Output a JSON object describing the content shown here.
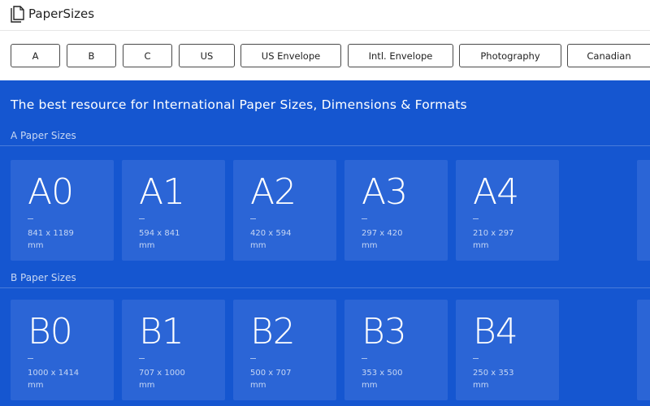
{
  "header": {
    "brand": "PaperSizes",
    "logo_icon": "document-pages-icon"
  },
  "tabs": [
    {
      "label": "A"
    },
    {
      "label": "B"
    },
    {
      "label": "C"
    },
    {
      "label": "US"
    },
    {
      "label": "US Envelope"
    },
    {
      "label": "Intl. Envelope"
    },
    {
      "label": "Photography"
    },
    {
      "label": "Canadian"
    }
  ],
  "hero": {
    "text": "The best resource for International Paper Sizes, Dimensions & Formats"
  },
  "sections": [
    {
      "title": "A Paper Sizes",
      "cards": [
        {
          "name": "A0",
          "dims": "841 x 1189",
          "unit": "mm"
        },
        {
          "name": "A1",
          "dims": "594 x 841",
          "unit": "mm"
        },
        {
          "name": "A2",
          "dims": "420 x 594",
          "unit": "mm"
        },
        {
          "name": "A3",
          "dims": "297 x 420",
          "unit": "mm"
        },
        {
          "name": "A4",
          "dims": "210 x 297",
          "unit": "mm"
        }
      ]
    },
    {
      "title": "B Paper Sizes",
      "cards": [
        {
          "name": "B0",
          "dims": "1000 x 1414",
          "unit": "mm"
        },
        {
          "name": "B1",
          "dims": "707 x 1000",
          "unit": "mm"
        },
        {
          "name": "B2",
          "dims": "500 x 707",
          "unit": "mm"
        },
        {
          "name": "B3",
          "dims": "353 x 500",
          "unit": "mm"
        },
        {
          "name": "B4",
          "dims": "250 x 353",
          "unit": "mm"
        }
      ]
    }
  ],
  "colors": {
    "page_background": "#1556d0",
    "card_background": "#2b65d6",
    "header_background": "#ffffff",
    "tab_border": "#4a4a4a"
  }
}
